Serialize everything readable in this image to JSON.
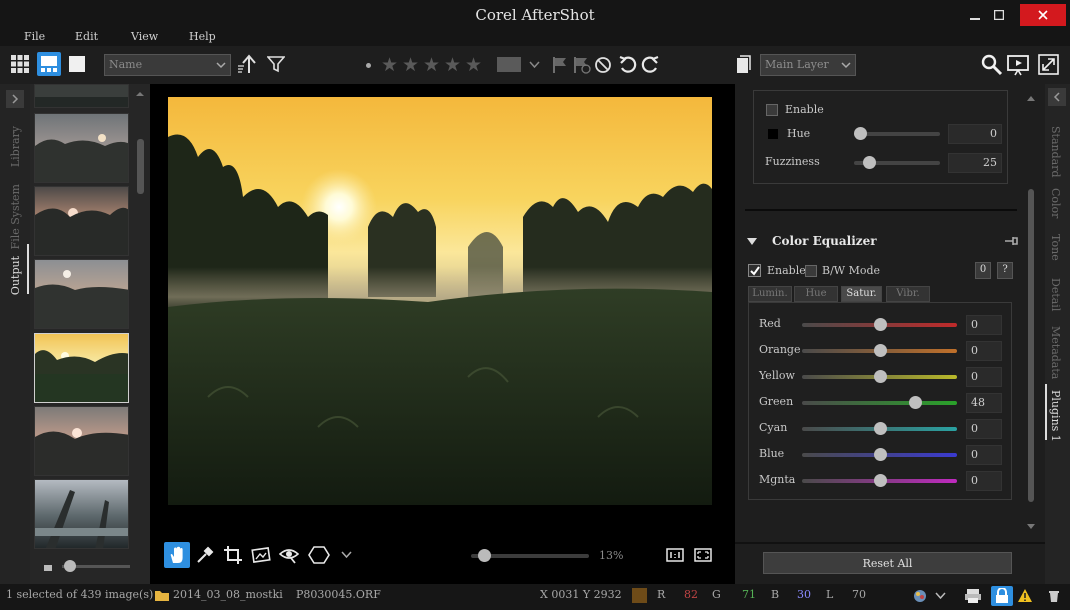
{
  "window": {
    "title": "Corel AfterShot"
  },
  "menu": {
    "file": "File",
    "edit": "Edit",
    "view": "View",
    "help": "Help"
  },
  "toolbar": {
    "sort_select": "Name",
    "layer_select": "Main Layer",
    "icons": [
      "grid-view-icon",
      "split-view-icon",
      "single-view-icon",
      "sort-direction-icon",
      "filter-icon",
      "rating-dot-icon",
      "star-icon",
      "color-label-icon",
      "flag-icon",
      "reject-flag-icon",
      "version-icon",
      "undo-icon",
      "redo-icon",
      "copy-icon",
      "search-icon",
      "slideshow-icon",
      "fullscreen-icon"
    ]
  },
  "left_tabs": {
    "library": "Library",
    "file_system": "File System",
    "output": "Output"
  },
  "viewer": {
    "zoom": "13%",
    "zoom_level": 0.13
  },
  "panel": {
    "enable_label": "Enable",
    "hue_label": "Hue",
    "hue_value": "0",
    "fuzziness_label": "Fuzziness",
    "fuzziness_value": "25",
    "section_title": "Color Equalizer",
    "eq_enable": "Enable",
    "eq_bw": "B/W Mode",
    "btn_zero": "0",
    "btn_help": "?",
    "tabs": [
      "Lumin.",
      "Hue",
      "Satur.",
      "Vibr."
    ],
    "active_tab": "Satur.",
    "channels": [
      {
        "name": "Red",
        "value": "0"
      },
      {
        "name": "Orange",
        "value": "0"
      },
      {
        "name": "Yellow",
        "value": "0"
      },
      {
        "name": "Green",
        "value": "48"
      },
      {
        "name": "Cyan",
        "value": "0"
      },
      {
        "name": "Blue",
        "value": "0"
      },
      {
        "name": "Mgnta",
        "value": "0"
      }
    ],
    "reset_all": "Reset All"
  },
  "right_tabs": {
    "standard": "Standard",
    "color": "Color",
    "tone": "Tone",
    "detail": "Detail",
    "metadata": "Metadata",
    "plugins": "Plugins 1"
  },
  "status": {
    "selection": "1 selected of 439 image(s)",
    "folder": "2014_03_08_mostki",
    "filename": "P8030045.ORF",
    "coords": "X 0031  Y 2932",
    "r_label": "R",
    "r_value": "82",
    "g_label": "G",
    "g_value": "71",
    "b_label": "B",
    "b_value": "30",
    "l_label": "L",
    "l_value": "70"
  },
  "colors": {
    "accent": "#2e8fe0",
    "close": "#d3191e",
    "sample_swatch": "#6e4b18"
  }
}
